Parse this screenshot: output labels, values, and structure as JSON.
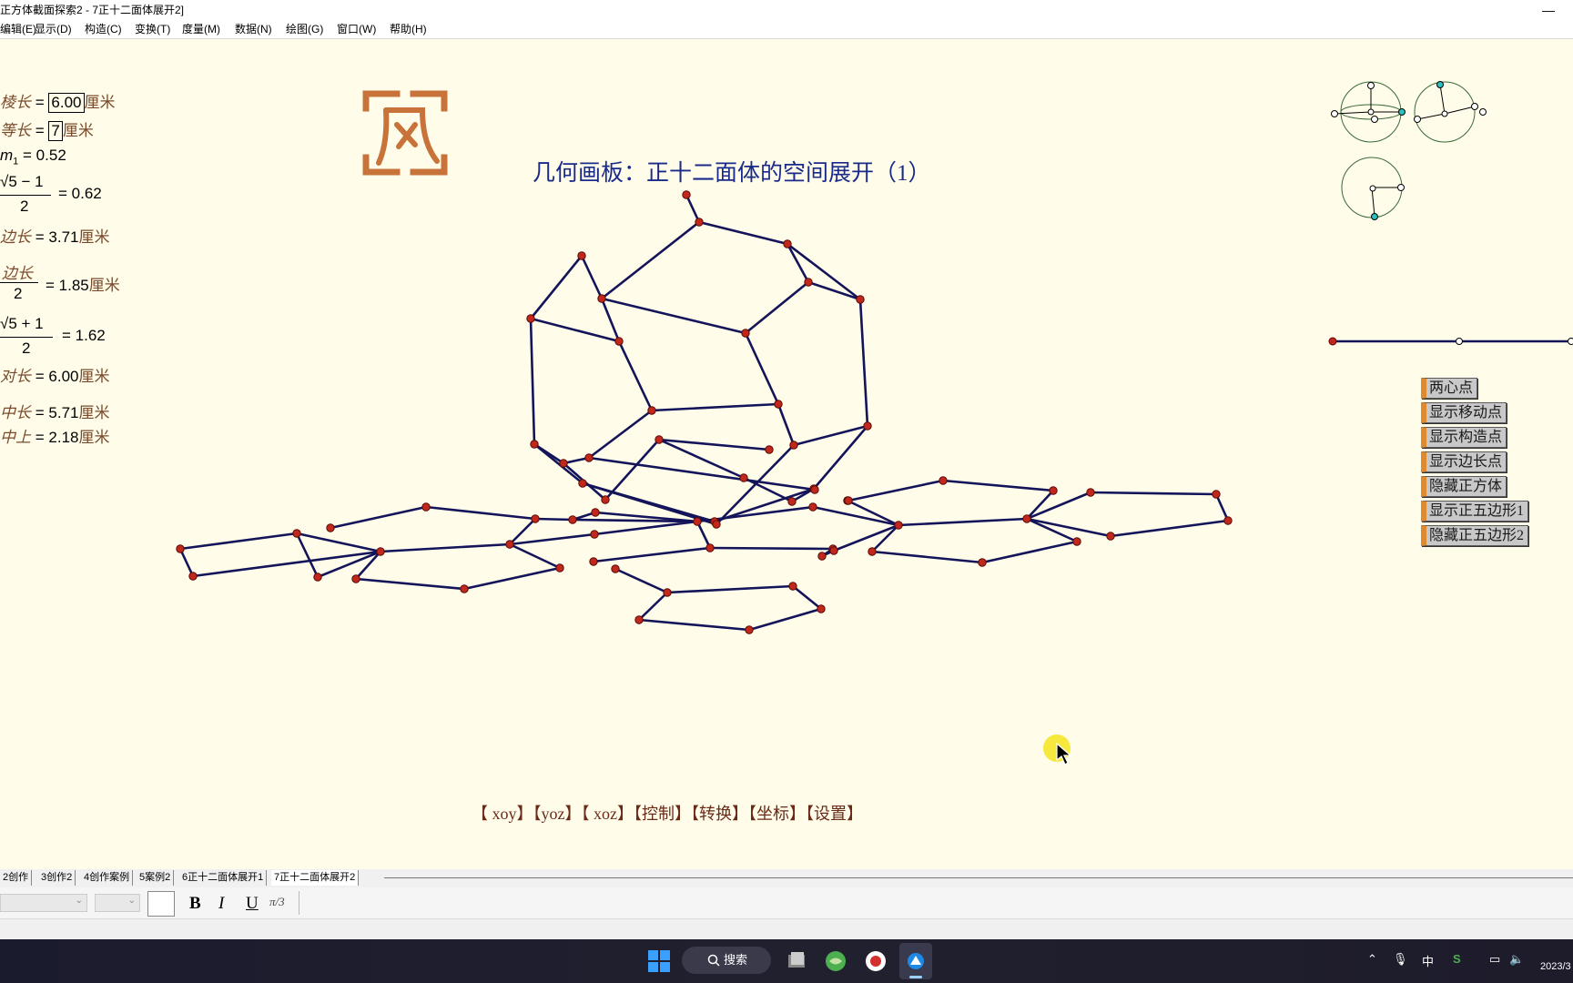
{
  "window": {
    "title": "正方体截面探索2 - 7正十二面体展开2]",
    "minimize_glyph": "—"
  },
  "menu": [
    "编辑(E)",
    "显示(D)",
    "构造(C)",
    "变换(T)",
    "度量(M)",
    "数据(N)",
    "绘图(G)",
    "窗口(W)",
    "帮助(H)"
  ],
  "page_title": "几何画板：正十二面体的空间展开（1）",
  "measures": {
    "edge_label": "棱长",
    "edge_value": "6.00",
    "edge_unit": "厘米",
    "eq_label": "等长",
    "eq_value": "7",
    "eq_unit": "厘米",
    "m1_label": "m",
    "m1_sub": "1",
    "m1_value": "= 0.52",
    "golden_small_num": "√5 − 1",
    "golden_small_den": "2",
    "golden_small_value": "= 0.62",
    "side_label": "边长",
    "side_value": "= 3.71",
    "side_unit": "厘米",
    "half_num": "边长",
    "half_den": "2",
    "half_value": "= 1.85",
    "half_unit": "厘米",
    "golden_big_num": "√5 + 1",
    "golden_big_den": "2",
    "golden_big_value": "= 1.62",
    "diag_label": "对长",
    "diag_value": "= 6.00",
    "diag_unit": "厘米",
    "mid_label": "中长",
    "mid_value": "= 5.71",
    "mid_unit": "厘米",
    "midtop_label": "中上",
    "midtop_value": "= 2.18",
    "midtop_unit": "厘米",
    "eq_sign": "="
  },
  "side_buttons": [
    "两心点",
    "显示移动点",
    "显示构造点",
    "显示边长点",
    "隐藏正方体",
    "显示正五边形1",
    "隐藏正五边形2"
  ],
  "bottom_links": "【 xoy】【yoz】【 xoz】【控制】【转换】【坐标】【设置】",
  "tabs": [
    "2创作",
    "3创作2",
    "4创作案例",
    "5案例2",
    "6正十二面体展开1",
    "7正十二面体展开2"
  ],
  "format_bar": {
    "bold": "B",
    "italic": "I",
    "underline": "U",
    "math": "π/3"
  },
  "taskbar": {
    "search_label": "搜索",
    "ime": "中",
    "date": "2023/3"
  },
  "colors": {
    "canvas_bg": "#fffdea",
    "edge": "#14145a",
    "vertex": "#c0281c",
    "title": "#1a2a8a",
    "button_accent": "#e08a30"
  }
}
